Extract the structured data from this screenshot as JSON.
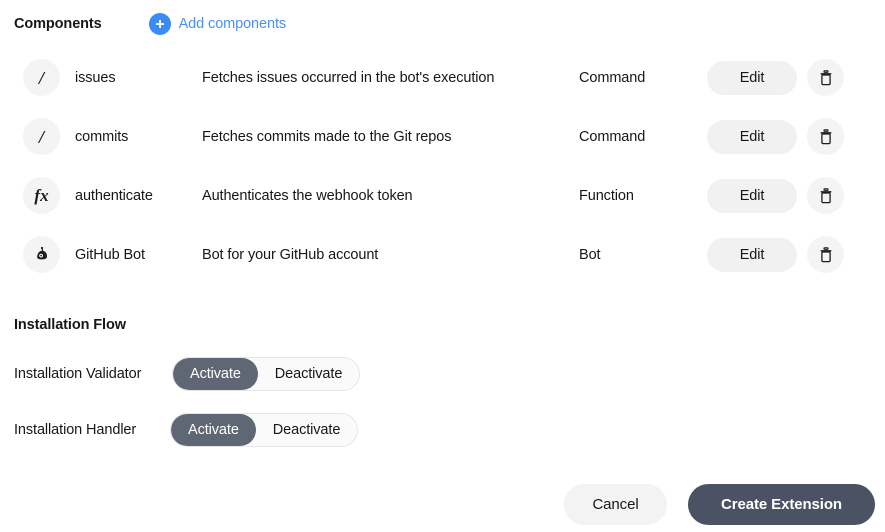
{
  "components_section": {
    "title": "Components",
    "add_label": "Add components",
    "add_icon": "plus-circle-icon",
    "accent_blue": "#4a91f2",
    "rows": [
      {
        "icon": "slash-command-icon",
        "icon_glyph": "/",
        "name": "issues",
        "description": "Fetches issues occurred in the bot's execution",
        "type": "Command",
        "edit_label": "Edit",
        "delete_icon": "trash-icon"
      },
      {
        "icon": "slash-command-icon",
        "icon_glyph": "/",
        "name": "commits",
        "description": "Fetches commits made to the Git repos",
        "type": "Command",
        "edit_label": "Edit",
        "delete_icon": "trash-icon"
      },
      {
        "icon": "function-fx-icon",
        "icon_glyph": "fx",
        "name": "authenticate",
        "description": "Authenticates the webhook token",
        "type": "Function",
        "edit_label": "Edit",
        "delete_icon": "trash-icon"
      },
      {
        "icon": "bot-icon",
        "icon_glyph": "",
        "name": "GitHub Bot",
        "description": "Bot for your GitHub account",
        "type": "Bot",
        "edit_label": "Edit",
        "delete_icon": "trash-icon"
      }
    ]
  },
  "installation_flow": {
    "title": "Installation Flow",
    "active_color": "#5f6775",
    "toggles": [
      {
        "label": "Installation Validator",
        "options": [
          "Activate",
          "Deactivate"
        ],
        "selected": "Activate"
      },
      {
        "label": "Installation Handler",
        "options": [
          "Activate",
          "Deactivate"
        ],
        "selected": "Activate"
      }
    ]
  },
  "footer": {
    "cancel_label": "Cancel",
    "create_label": "Create Extension",
    "create_color": "#4b5263"
  }
}
